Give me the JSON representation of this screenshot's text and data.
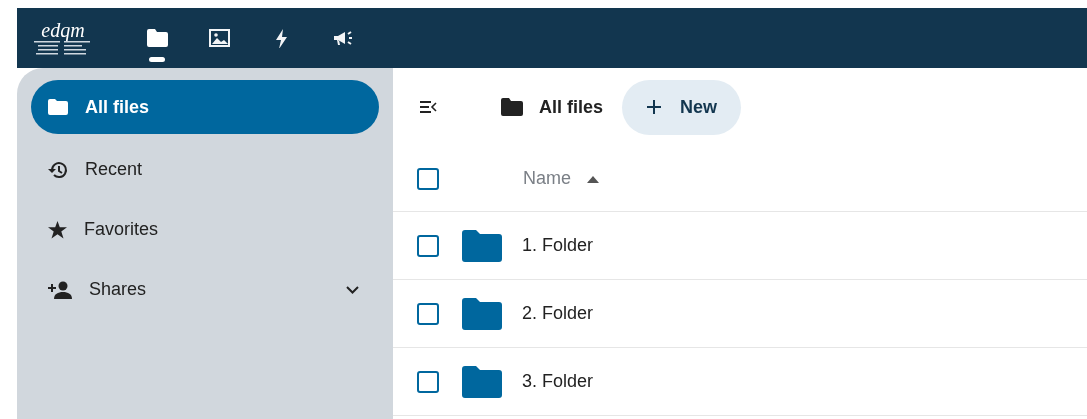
{
  "header": {
    "logo": {
      "text": "edqm"
    },
    "apps": [
      {
        "kind": "folder",
        "selected": true
      },
      {
        "kind": "image",
        "selected": false
      },
      {
        "kind": "bolt",
        "selected": false
      },
      {
        "kind": "megaphone",
        "selected": false
      }
    ]
  },
  "sidebar": {
    "items": [
      {
        "kind": "folder",
        "label": "All files",
        "selected": true,
        "expandable": false
      },
      {
        "kind": "history",
        "label": "Recent",
        "selected": false,
        "expandable": false
      },
      {
        "kind": "star",
        "label": "Favorites",
        "selected": false,
        "expandable": false
      },
      {
        "kind": "share",
        "label": "Shares",
        "selected": false,
        "expandable": true
      }
    ]
  },
  "breadcrumb": {
    "label": "All files"
  },
  "new_button": {
    "label": "New"
  },
  "table": {
    "columns": [
      {
        "label": "Name",
        "sorted_ascending": true
      }
    ],
    "all_checked": false,
    "rows": [
      {
        "name": "1. Folder",
        "checked": false
      },
      {
        "name": "2. Folder",
        "checked": false
      },
      {
        "name": "3. Folder",
        "checked": false
      }
    ]
  }
}
